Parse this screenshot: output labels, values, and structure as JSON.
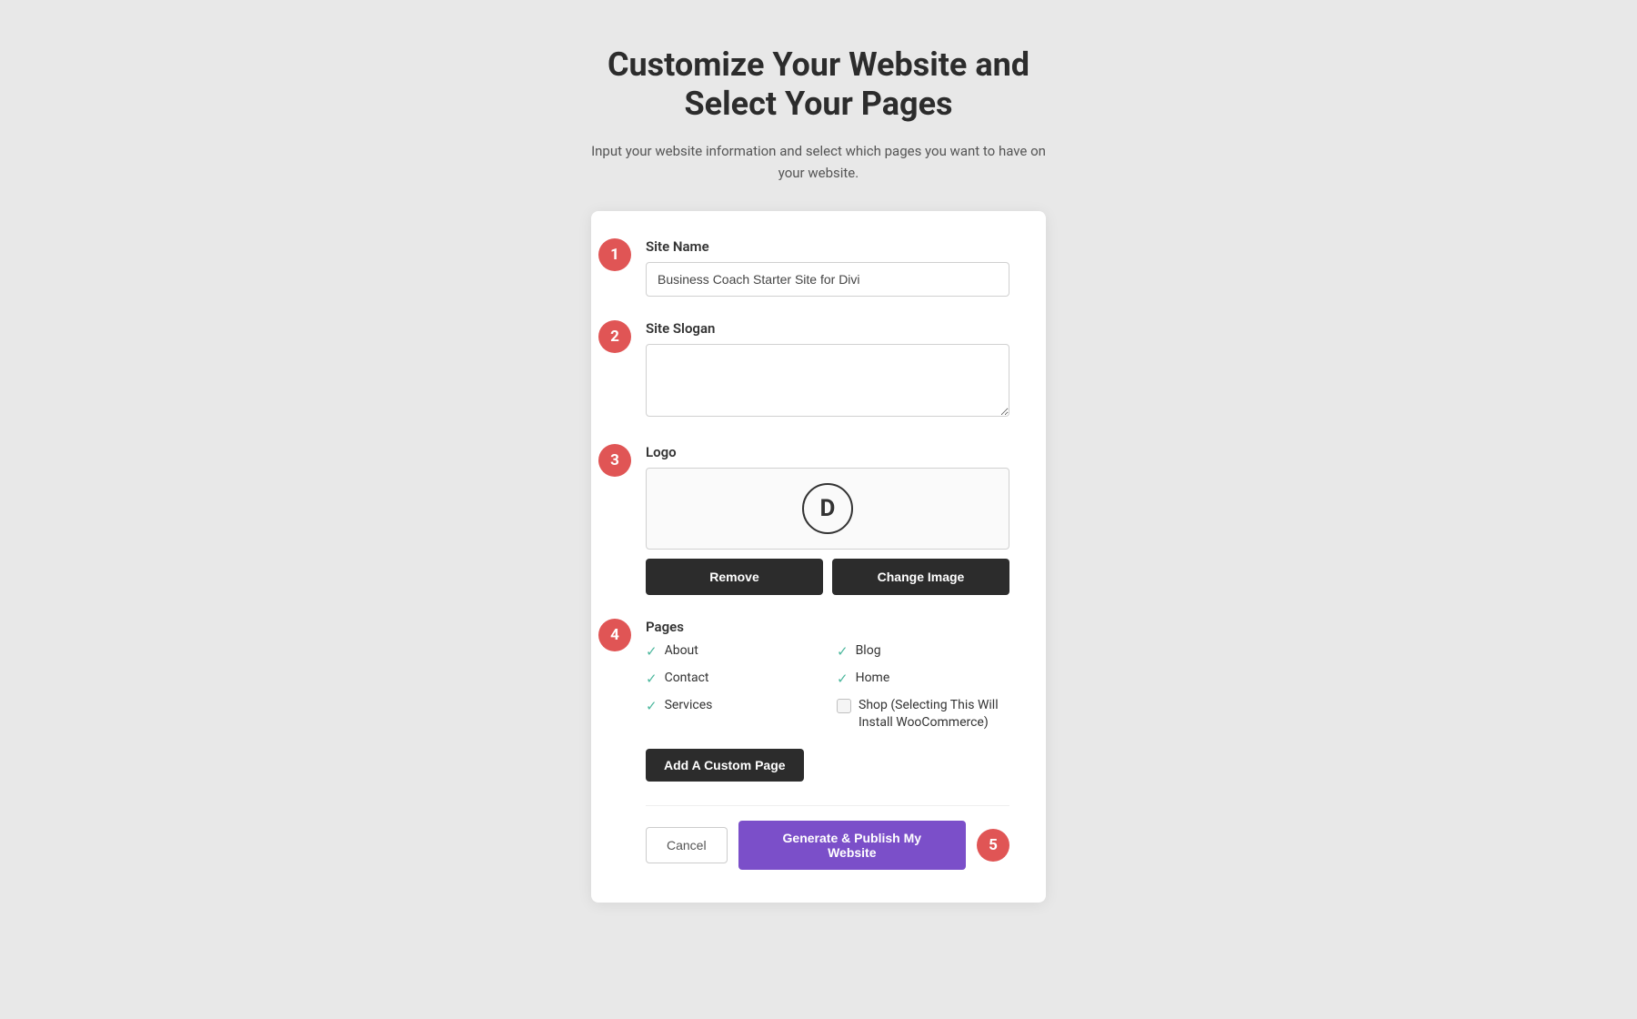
{
  "header": {
    "title_line1": "Customize Your Website and",
    "title_line2": "Select Your Pages",
    "subtitle": "Input your website information and select which pages you want to have on your website."
  },
  "steps": {
    "step1": {
      "badge": "1",
      "label": "Site Name",
      "value": "Business Coach Starter Site for Divi",
      "placeholder": "Business Coach Starter Site for Divi"
    },
    "step2": {
      "badge": "2",
      "label": "Site Slogan",
      "value": "",
      "placeholder": ""
    },
    "step3": {
      "badge": "3",
      "label": "Logo",
      "logo_letter": "D",
      "remove_btn": "Remove",
      "change_btn": "Change Image"
    },
    "step4": {
      "badge": "4",
      "label": "Pages",
      "pages": [
        {
          "name": "About",
          "checked": true,
          "col": 0
        },
        {
          "name": "Blog",
          "checked": true,
          "col": 1
        },
        {
          "name": "Contact",
          "checked": true,
          "col": 0
        },
        {
          "name": "Home",
          "checked": true,
          "col": 1
        },
        {
          "name": "Services",
          "checked": true,
          "col": 0
        },
        {
          "name": "Shop (Selecting This Will Install WooCommerce)",
          "checked": false,
          "col": 1
        }
      ],
      "add_custom_btn": "Add A Custom Page"
    }
  },
  "actions": {
    "cancel_btn": "Cancel",
    "publish_btn": "Generate & Publish My Website",
    "step5_badge": "5"
  }
}
